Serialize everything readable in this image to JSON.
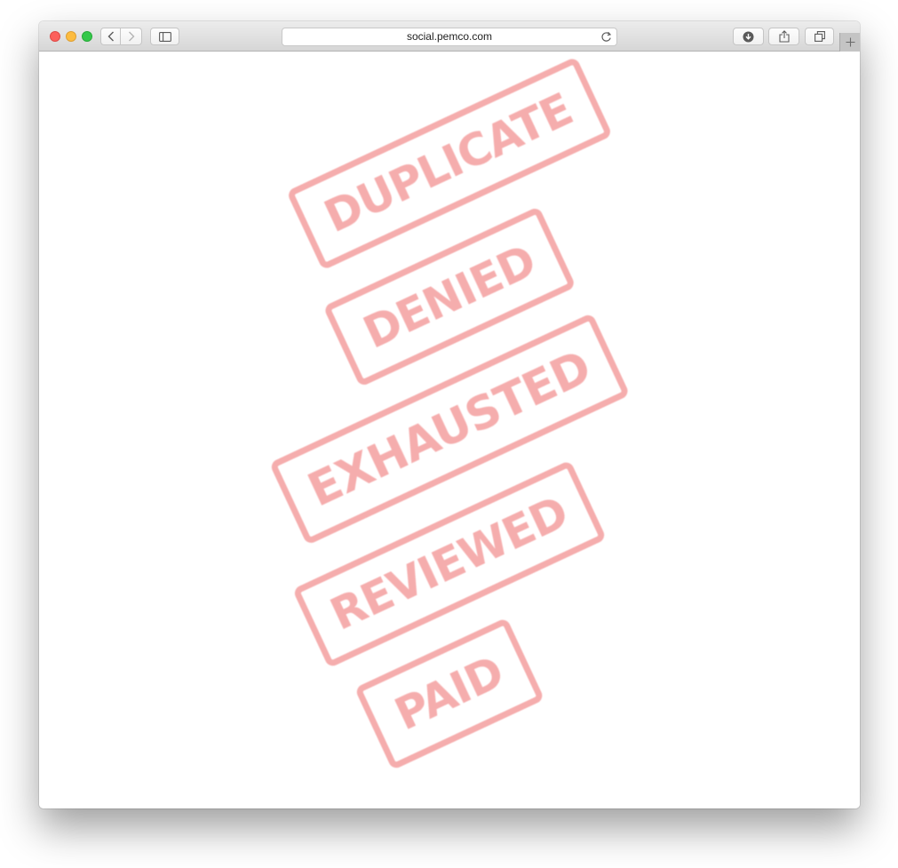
{
  "browser": {
    "address": "social.pemco.com",
    "icons": {
      "back": "chevron-left-icon",
      "forward": "chevron-right-icon",
      "sidebar": "sidebar-icon",
      "reload": "reload-icon",
      "download": "download-icon",
      "share": "share-icon",
      "tabs": "tabs-overview-icon",
      "new_tab": "plus-icon"
    },
    "traffic_lights": {
      "close": "#fc605c",
      "minimize": "#fdbc40",
      "zoom": "#34c84a"
    }
  },
  "stamps": {
    "color": "#f5a9a9",
    "items": [
      {
        "label": "DUPLICATE"
      },
      {
        "label": "DENIED"
      },
      {
        "label": "EXHAUSTED"
      },
      {
        "label": "REVIEWED"
      },
      {
        "label": "PAID"
      }
    ]
  }
}
